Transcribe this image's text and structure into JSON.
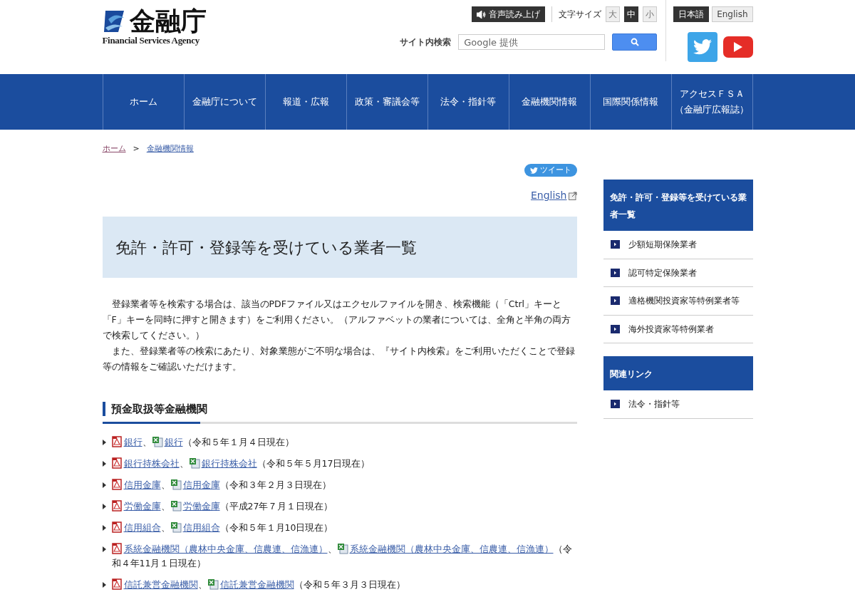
{
  "header": {
    "logo_title": "金融庁",
    "logo_subtitle": "Financial Services Agency",
    "speech_button": "音声読み上げ",
    "font_size_label": "文字サイズ",
    "font_sizes": [
      {
        "label": "大",
        "selected": false
      },
      {
        "label": "中",
        "selected": true
      },
      {
        "label": "小",
        "selected": false
      }
    ],
    "languages": [
      {
        "label": "日本語",
        "selected": true
      },
      {
        "label": "English",
        "selected": false
      }
    ],
    "search_label": "サイト内検索",
    "search_placeholder": "Google 提供"
  },
  "nav": [
    "ホーム",
    "金融庁について",
    "報道・広報",
    "政策・審議会等",
    "法令・指針等",
    "金融機関情報",
    "国際関係情報",
    [
      "アクセスＦＳＡ",
      "（金融庁広報誌）"
    ]
  ],
  "breadcrumb": [
    {
      "label": "ホーム",
      "visited": true
    },
    {
      "label": "金融機関情報",
      "visited": false
    }
  ],
  "breadcrumb_separator": ">",
  "tweet_button": "ツイート",
  "english_link": "English",
  "page_title": "免許・許可・登録等を受けている業者一覧",
  "paragraphs": [
    "　登録業者等を検索する場合は、該当のPDFファイル又はエクセルファイルを開き、検索機能（「Ctrl」キーと「F」キーを同時に押すと開きます）をご利用ください。（アルファベットの業者については、全角と半角の両方で検索してください。）",
    "　また、登録業者等の検索にあたり、対象業態がご不明な場合は、『サイト内検索』をご利用いただくことで登録等の情報をご確認いただけます。"
  ],
  "section_heading": "預金取扱等金融機関",
  "files": [
    {
      "pdf": "銀行",
      "sep": "、",
      "excel": "銀行",
      "note": "（令和５年１月４日現在）"
    },
    {
      "pdf": "銀行持株会社",
      "sep": "、",
      "excel": "銀行持株会社",
      "note": "（令和５年５月17日現在）"
    },
    {
      "pdf": "信用金庫",
      "sep": "、",
      "excel": "信用金庫",
      "note": "（令和３年２月３日現在）"
    },
    {
      "pdf": "労働金庫",
      "sep": "、",
      "excel": "労働金庫",
      "note": "（平成27年７月１日現在）"
    },
    {
      "pdf": "信用組合",
      "sep": "、",
      "excel": "信用組合",
      "note": "（令和５年１月10日現在）"
    },
    {
      "pdf": "系統金融機関（農林中央金庫、信農連、信漁連）",
      "sep": "、",
      "excel": "系統金融機関（農林中央金庫、信農連、信漁連）",
      "note": "（令和４年11月１日現在）"
    },
    {
      "pdf": "信託兼営金融機関",
      "sep": "、",
      "excel": "信託兼営金融機関",
      "note": "（令和５年３月３日現在）"
    }
  ],
  "sidebar": [
    {
      "title": "免許・許可・登録等を受けている業者一覧",
      "items": [
        "少額短期保険業者",
        "認可特定保険業者",
        "適格機関投資家等特例業者等",
        "海外投資家等特例業者"
      ]
    },
    {
      "title": "関連リンク",
      "items": [
        "法令・指針等"
      ]
    }
  ]
}
